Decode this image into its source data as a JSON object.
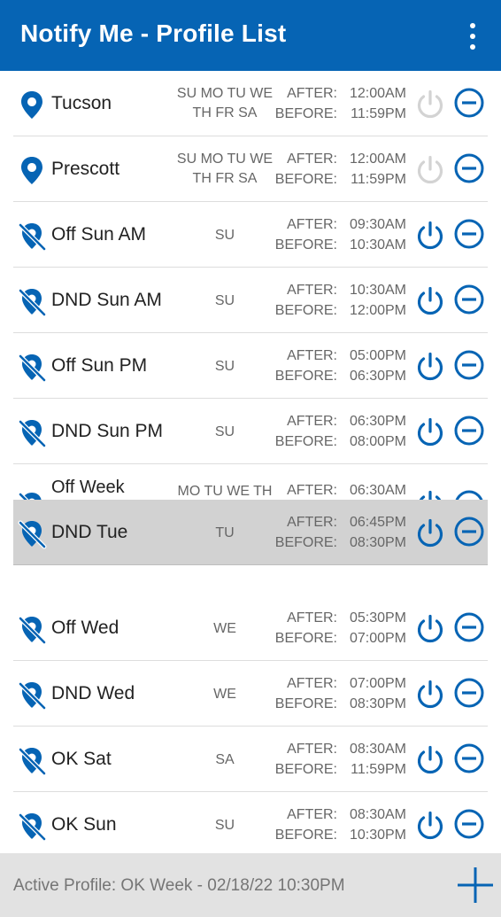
{
  "header": {
    "title": "Notify Me - Profile List",
    "menu_icon": "more-vert-icon",
    "background": "#0664b4"
  },
  "labels": {
    "after": "AFTER:",
    "before": "BEFORE:"
  },
  "profiles": [
    {
      "name": "Tucson",
      "days": "SU MO TU WE\nTH FR SA",
      "after": "12:00AM",
      "before": "11:59PM",
      "location_icon": "location-pin-icon",
      "power_state": "inactive"
    },
    {
      "name": "Prescott",
      "days": "SU MO TU WE\nTH FR SA",
      "after": "12:00AM",
      "before": "11:59PM",
      "location_icon": "location-pin-icon",
      "power_state": "inactive"
    },
    {
      "name": "Off Sun AM",
      "days": "SU",
      "after": "09:30AM",
      "before": "10:30AM",
      "location_icon": "location-off-icon",
      "power_state": "active"
    },
    {
      "name": "DND Sun AM",
      "days": "SU",
      "after": "10:30AM",
      "before": "12:00PM",
      "location_icon": "location-off-icon",
      "power_state": "active"
    },
    {
      "name": "Off Sun PM",
      "days": "SU",
      "after": "05:00PM",
      "before": "06:30PM",
      "location_icon": "location-off-icon",
      "power_state": "active"
    },
    {
      "name": "DND Sun PM",
      "days": "SU",
      "after": "06:30PM",
      "before": "08:00PM",
      "location_icon": "location-off-icon",
      "power_state": "active"
    },
    {
      "name": "Off Week",
      "days": "MO TU WE TH",
      "after": "06:30AM",
      "location_icon": "location-off-icon",
      "power_state": "active"
    },
    {
      "name": "DND Tue",
      "days": "TU",
      "after": "06:45PM",
      "before": "08:30PM",
      "location_icon": "location-off-icon",
      "power_state": "active",
      "state": "selected-dragging"
    },
    {
      "name": "Off Wed",
      "days": "WE",
      "after": "05:30PM",
      "before": "07:00PM",
      "location_icon": "location-off-icon",
      "power_state": "active"
    },
    {
      "name": "DND Wed",
      "days": "WE",
      "after": "07:00PM",
      "before": "08:30PM",
      "location_icon": "location-off-icon",
      "power_state": "active"
    },
    {
      "name": "OK Sat",
      "days": "SA",
      "after": "08:30AM",
      "before": "11:59PM",
      "location_icon": "location-off-icon",
      "power_state": "active"
    },
    {
      "name": "OK Sun",
      "days": "SU",
      "after": "08:30AM",
      "before": "10:30PM",
      "location_icon": "location-off-icon",
      "power_state": "active"
    }
  ],
  "footer": {
    "active_profile": "Active Profile: OK Week - 02/18/22 10:30PM",
    "add_icon": "add-icon"
  },
  "colors": {
    "accent": "#0664b4",
    "inactive_icon": "#d3d3d3",
    "selected_row": "#d2d2d2",
    "footer_bg": "#e2e2e2"
  }
}
